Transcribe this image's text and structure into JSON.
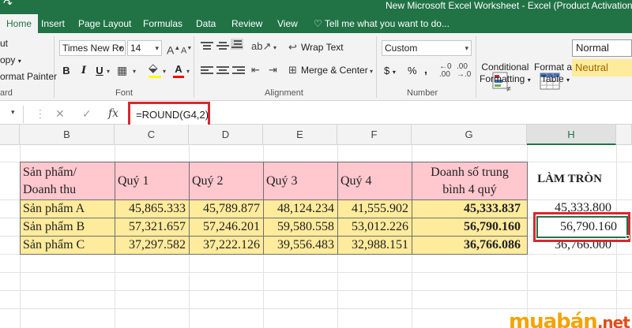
{
  "window": {
    "title": "New Microsoft Excel Worksheet - Excel (Product Activation Faile",
    "qat_icon": "redo-icon"
  },
  "tabs": [
    {
      "label": "Home",
      "active": true
    },
    {
      "label": "Insert"
    },
    {
      "label": "Page Layout"
    },
    {
      "label": "Formulas"
    },
    {
      "label": "Data"
    },
    {
      "label": "Review"
    },
    {
      "label": "View"
    }
  ],
  "tell_me": "Tell me what you want to do...",
  "clipboard": {
    "cut": "ut",
    "copy": "opy",
    "format_painter": "ormat Painter",
    "group_label": "ard"
  },
  "font": {
    "name": "Times New Ro",
    "size": "14",
    "bold": "B",
    "italic": "I",
    "underline": "U",
    "font_color_letter": "A",
    "grow": "A",
    "shrink": "A",
    "group_label": "Font"
  },
  "alignment": {
    "wrap_text": "Wrap Text",
    "merge_center": "Merge & Center",
    "group_label": "Alignment"
  },
  "number": {
    "format": "Custom",
    "currency": "$",
    "percent": "%",
    "comma": ",",
    "group_label": "Number"
  },
  "styles": {
    "conditional_formatting": [
      "Conditional",
      "Formatting"
    ],
    "format_as_table": [
      "Format as",
      "Table"
    ],
    "normal": "Normal",
    "neutral": "Neutral"
  },
  "formula_bar": {
    "cancel": "✕",
    "enter": "✓",
    "fx": "fx",
    "formula": "=ROUND(G4,2)"
  },
  "columns": [
    "B",
    "C",
    "D",
    "E",
    "F",
    "G",
    "H"
  ],
  "table": {
    "headers": [
      "Sản phẩm/ Doanh thu",
      "Quý 1",
      "Quý 2",
      "Quý 3",
      "Quý 4",
      "Doanh số trung bình 4 quý"
    ],
    "header_line1": "Sản phẩm/",
    "header_line2": "Doanh thu",
    "avg_line1": "Doanh số trung",
    "avg_line2": "bình 4 quý",
    "rounding_header": "LÀM TRÒN",
    "rows": [
      {
        "product": "Sản phẩm A",
        "q1": "45,865.333",
        "q2": "45,789.877",
        "q3": "48,124.234",
        "q4": "41,555.902",
        "avg": "45,333.837",
        "rounded": "45,333.800"
      },
      {
        "product": "Sản phẩm B",
        "q1": "57,321.657",
        "q2": "57,246.201",
        "q3": "59,580.558",
        "q4": "53,012.226",
        "avg": "56,790.160",
        "rounded": "56,790.160"
      },
      {
        "product": "Sản phẩm C",
        "q1": "37,297.582",
        "q2": "37,222.126",
        "q3": "39,556.483",
        "q4": "32,988.151",
        "avg": "36,766.086",
        "rounded": "36,766.000"
      }
    ]
  },
  "watermark": {
    "brand": "muabán",
    "tld": ".net"
  },
  "colors": {
    "excel_green": "#217346",
    "header_pink": "#ffc7ce",
    "row_yellow": "#ffeb9c",
    "highlight_red": "#d9272e"
  }
}
